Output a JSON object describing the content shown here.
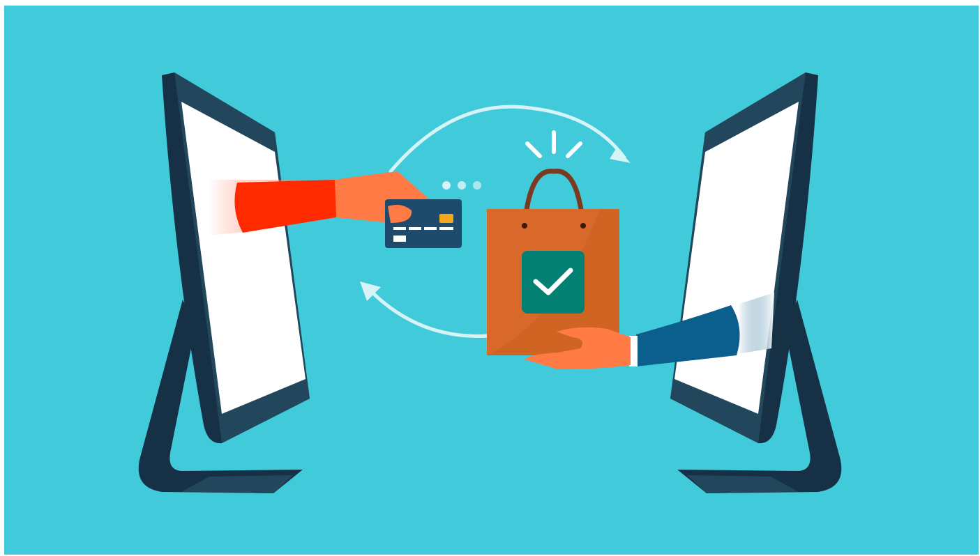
{
  "scene": {
    "kind": "illustration",
    "colors": {
      "background": "#41cad9",
      "frame": "#ffffff",
      "monitor_dark": "#163145",
      "monitor_mid": "#22465c",
      "screen": "#ffffff",
      "arrow": "#d6f3f7",
      "sleeve_left": "#ff2a00",
      "sleeve_right": "#0b5f8c",
      "skin": "#ff7a45",
      "card": "#1e4a6b",
      "card_chip": "#f7a71c",
      "bag": "#d9692a",
      "bag_handle": "#7a3a22",
      "badge": "#028072",
      "check": "#ffffff"
    },
    "icons": [
      "left-monitor-icon",
      "right-monitor-icon",
      "credit-card-icon",
      "shopping-bag-icon",
      "checkmark-icon",
      "exchange-arrows-icon",
      "loading-dots-icon",
      "sparkle-lines-icon"
    ]
  }
}
